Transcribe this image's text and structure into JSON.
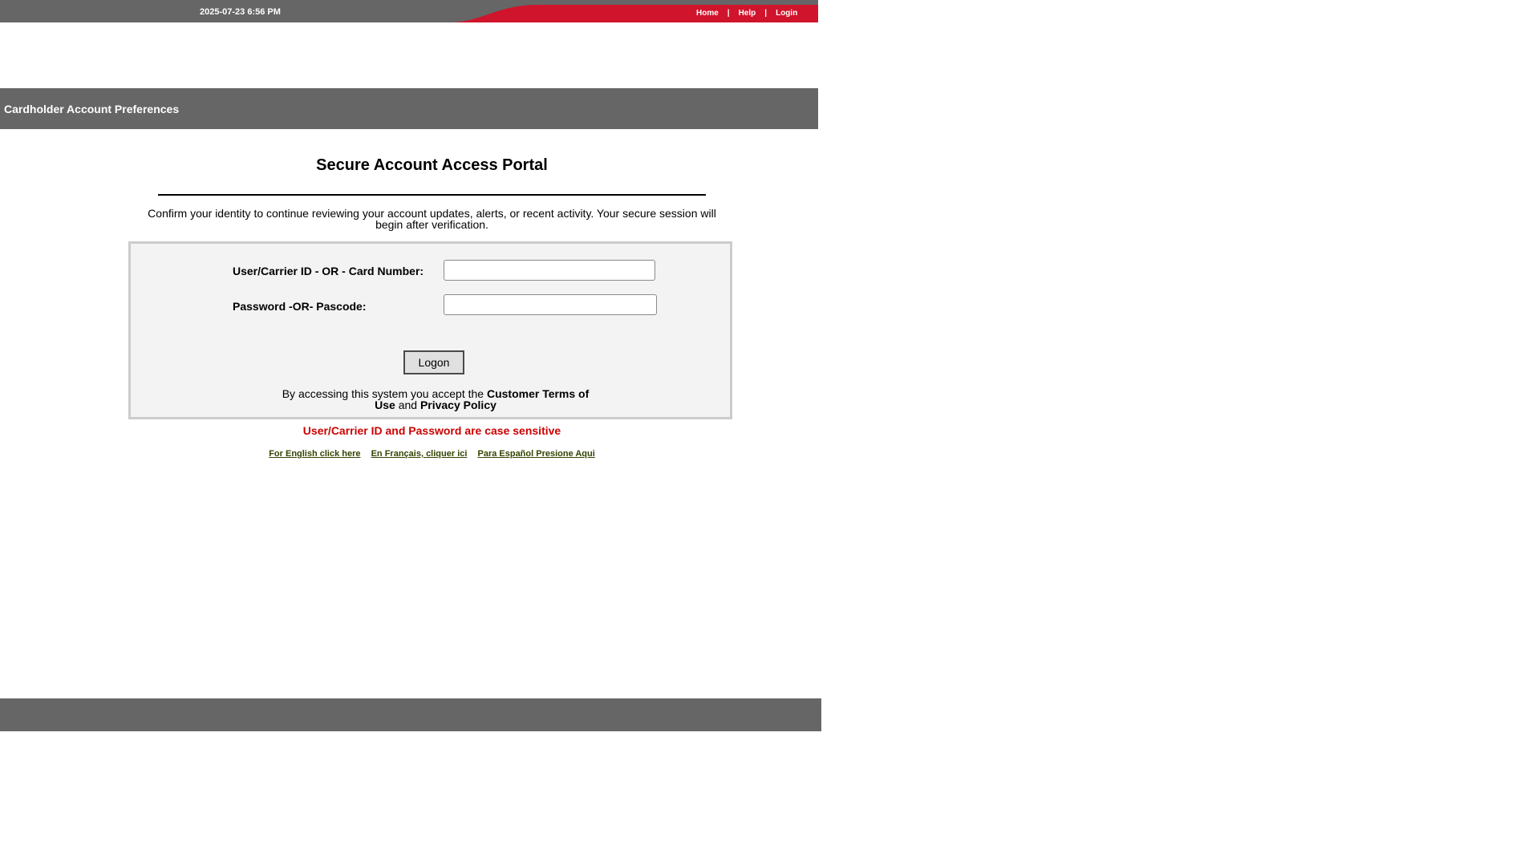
{
  "top_bar": {
    "datetime": "2025-07-23 6:56 PM",
    "nav": {
      "home": "Home",
      "separator": "|",
      "help": "Help",
      "login": "Login"
    },
    "colors": {
      "bar": "#666666",
      "accent": "#d0142c"
    }
  },
  "section_header": {
    "title": "Cardholder Account Preferences"
  },
  "main": {
    "title": "Secure Account Access Portal",
    "intro": "Confirm your identity to continue reviewing your account updates, alerts, or recent activity. Your secure session will begin after verification."
  },
  "login_form": {
    "user_label": "User/Carrier ID - OR - Card Number:",
    "user_value": "",
    "user_placeholder": "",
    "password_label": "Password -OR- Pascode:",
    "password_value": "",
    "password_placeholder": "",
    "logon_label": "Logon",
    "terms_prefix": "By accessing this system you accept the",
    "terms_link": "Customer Terms of Use",
    "terms_and": "and",
    "privacy_link": "Privacy Policy"
  },
  "case_warning": "User/Carrier ID and Password are case sensitive",
  "language_links": {
    "english": "For English click here",
    "french": "En Français, cliquer ici",
    "spanish": "Para Español Presione Aqui"
  }
}
